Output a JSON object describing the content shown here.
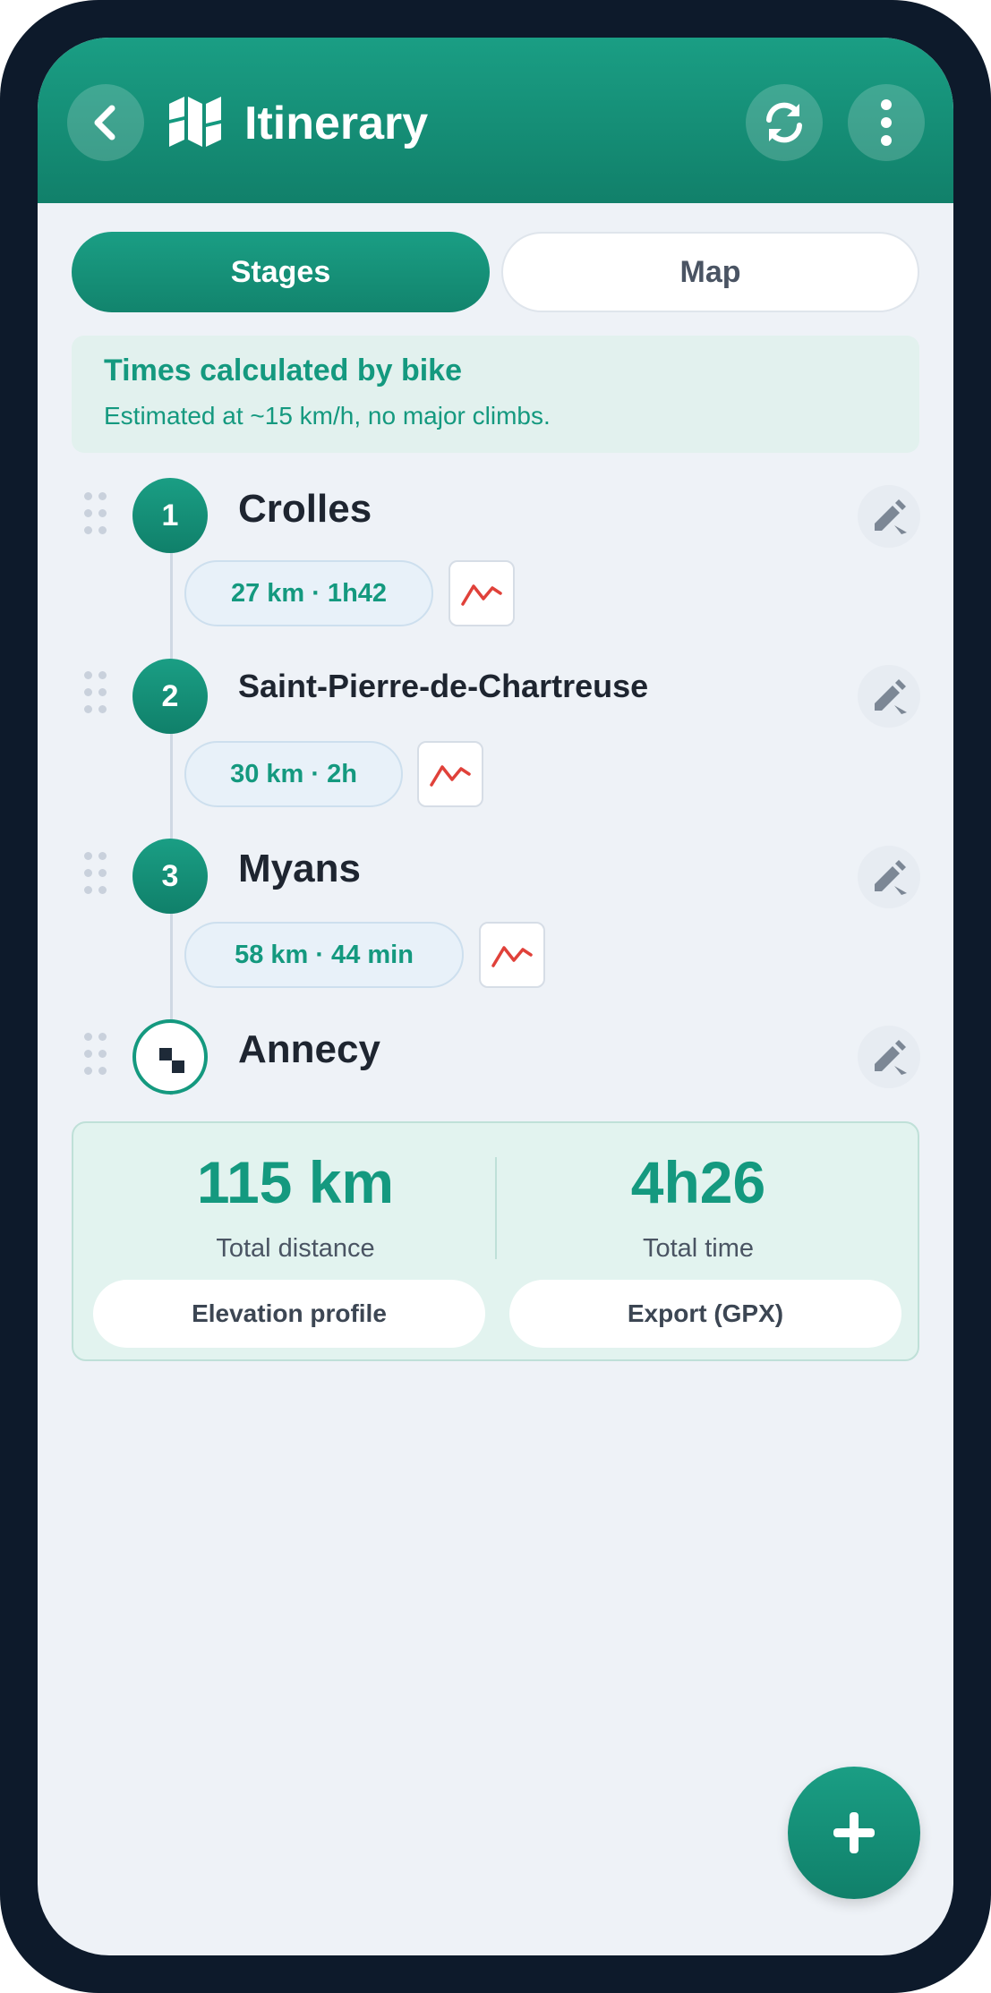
{
  "header": {
    "title": "Itinerary",
    "back_icon": "chevron-left-icon",
    "map_icon": "map-icon",
    "sync_icon": "refresh-icon",
    "more_icon": "more-vertical-icon"
  },
  "tabs": [
    {
      "label": "Stages",
      "active": true
    },
    {
      "label": "Map",
      "active": false
    }
  ],
  "info": {
    "title": "Times calculated by bike",
    "subtitle": "Estimated at ~15 km/h, no major climbs."
  },
  "stages": [
    {
      "number": "1",
      "name": "Crolles",
      "leg": "27 km · 1h42"
    },
    {
      "number": "2",
      "name": "Saint-Pierre-de-Chartreuse",
      "leg": "30 km · 2h"
    },
    {
      "number": "3",
      "name": "Myans",
      "leg": "58 km · 44 min"
    }
  ],
  "destination": {
    "name": "Annecy"
  },
  "summary": {
    "distance_value": "115 km",
    "distance_label": "Total distance",
    "time_value": "4h26",
    "time_label": "Total time",
    "elevation_button": "Elevation profile",
    "export_button": "Export (GPX)"
  },
  "fab": {
    "icon": "plus-icon"
  },
  "colors": {
    "primary": "#14997f",
    "frame": "#0d1a2b",
    "background": "#eef2f7",
    "trend": "#e0413a"
  }
}
